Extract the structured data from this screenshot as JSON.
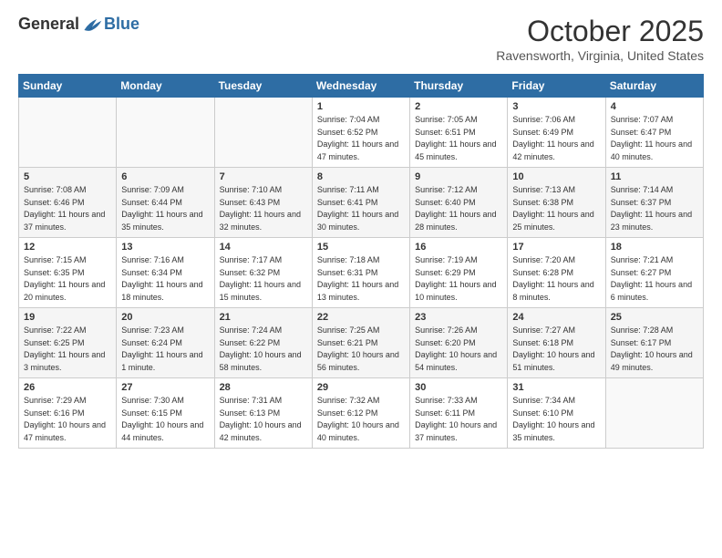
{
  "header": {
    "logo_general": "General",
    "logo_blue": "Blue",
    "month_title": "October 2025",
    "location": "Ravensworth, Virginia, United States"
  },
  "days_of_week": [
    "Sunday",
    "Monday",
    "Tuesday",
    "Wednesday",
    "Thursday",
    "Friday",
    "Saturday"
  ],
  "weeks": [
    [
      {
        "day": "",
        "sunrise": "",
        "sunset": "",
        "daylight": ""
      },
      {
        "day": "",
        "sunrise": "",
        "sunset": "",
        "daylight": ""
      },
      {
        "day": "",
        "sunrise": "",
        "sunset": "",
        "daylight": ""
      },
      {
        "day": "1",
        "sunrise": "Sunrise: 7:04 AM",
        "sunset": "Sunset: 6:52 PM",
        "daylight": "Daylight: 11 hours and 47 minutes."
      },
      {
        "day": "2",
        "sunrise": "Sunrise: 7:05 AM",
        "sunset": "Sunset: 6:51 PM",
        "daylight": "Daylight: 11 hours and 45 minutes."
      },
      {
        "day": "3",
        "sunrise": "Sunrise: 7:06 AM",
        "sunset": "Sunset: 6:49 PM",
        "daylight": "Daylight: 11 hours and 42 minutes."
      },
      {
        "day": "4",
        "sunrise": "Sunrise: 7:07 AM",
        "sunset": "Sunset: 6:47 PM",
        "daylight": "Daylight: 11 hours and 40 minutes."
      }
    ],
    [
      {
        "day": "5",
        "sunrise": "Sunrise: 7:08 AM",
        "sunset": "Sunset: 6:46 PM",
        "daylight": "Daylight: 11 hours and 37 minutes."
      },
      {
        "day": "6",
        "sunrise": "Sunrise: 7:09 AM",
        "sunset": "Sunset: 6:44 PM",
        "daylight": "Daylight: 11 hours and 35 minutes."
      },
      {
        "day": "7",
        "sunrise": "Sunrise: 7:10 AM",
        "sunset": "Sunset: 6:43 PM",
        "daylight": "Daylight: 11 hours and 32 minutes."
      },
      {
        "day": "8",
        "sunrise": "Sunrise: 7:11 AM",
        "sunset": "Sunset: 6:41 PM",
        "daylight": "Daylight: 11 hours and 30 minutes."
      },
      {
        "day": "9",
        "sunrise": "Sunrise: 7:12 AM",
        "sunset": "Sunset: 6:40 PM",
        "daylight": "Daylight: 11 hours and 28 minutes."
      },
      {
        "day": "10",
        "sunrise": "Sunrise: 7:13 AM",
        "sunset": "Sunset: 6:38 PM",
        "daylight": "Daylight: 11 hours and 25 minutes."
      },
      {
        "day": "11",
        "sunrise": "Sunrise: 7:14 AM",
        "sunset": "Sunset: 6:37 PM",
        "daylight": "Daylight: 11 hours and 23 minutes."
      }
    ],
    [
      {
        "day": "12",
        "sunrise": "Sunrise: 7:15 AM",
        "sunset": "Sunset: 6:35 PM",
        "daylight": "Daylight: 11 hours and 20 minutes."
      },
      {
        "day": "13",
        "sunrise": "Sunrise: 7:16 AM",
        "sunset": "Sunset: 6:34 PM",
        "daylight": "Daylight: 11 hours and 18 minutes."
      },
      {
        "day": "14",
        "sunrise": "Sunrise: 7:17 AM",
        "sunset": "Sunset: 6:32 PM",
        "daylight": "Daylight: 11 hours and 15 minutes."
      },
      {
        "day": "15",
        "sunrise": "Sunrise: 7:18 AM",
        "sunset": "Sunset: 6:31 PM",
        "daylight": "Daylight: 11 hours and 13 minutes."
      },
      {
        "day": "16",
        "sunrise": "Sunrise: 7:19 AM",
        "sunset": "Sunset: 6:29 PM",
        "daylight": "Daylight: 11 hours and 10 minutes."
      },
      {
        "day": "17",
        "sunrise": "Sunrise: 7:20 AM",
        "sunset": "Sunset: 6:28 PM",
        "daylight": "Daylight: 11 hours and 8 minutes."
      },
      {
        "day": "18",
        "sunrise": "Sunrise: 7:21 AM",
        "sunset": "Sunset: 6:27 PM",
        "daylight": "Daylight: 11 hours and 6 minutes."
      }
    ],
    [
      {
        "day": "19",
        "sunrise": "Sunrise: 7:22 AM",
        "sunset": "Sunset: 6:25 PM",
        "daylight": "Daylight: 11 hours and 3 minutes."
      },
      {
        "day": "20",
        "sunrise": "Sunrise: 7:23 AM",
        "sunset": "Sunset: 6:24 PM",
        "daylight": "Daylight: 11 hours and 1 minute."
      },
      {
        "day": "21",
        "sunrise": "Sunrise: 7:24 AM",
        "sunset": "Sunset: 6:22 PM",
        "daylight": "Daylight: 10 hours and 58 minutes."
      },
      {
        "day": "22",
        "sunrise": "Sunrise: 7:25 AM",
        "sunset": "Sunset: 6:21 PM",
        "daylight": "Daylight: 10 hours and 56 minutes."
      },
      {
        "day": "23",
        "sunrise": "Sunrise: 7:26 AM",
        "sunset": "Sunset: 6:20 PM",
        "daylight": "Daylight: 10 hours and 54 minutes."
      },
      {
        "day": "24",
        "sunrise": "Sunrise: 7:27 AM",
        "sunset": "Sunset: 6:18 PM",
        "daylight": "Daylight: 10 hours and 51 minutes."
      },
      {
        "day": "25",
        "sunrise": "Sunrise: 7:28 AM",
        "sunset": "Sunset: 6:17 PM",
        "daylight": "Daylight: 10 hours and 49 minutes."
      }
    ],
    [
      {
        "day": "26",
        "sunrise": "Sunrise: 7:29 AM",
        "sunset": "Sunset: 6:16 PM",
        "daylight": "Daylight: 10 hours and 47 minutes."
      },
      {
        "day": "27",
        "sunrise": "Sunrise: 7:30 AM",
        "sunset": "Sunset: 6:15 PM",
        "daylight": "Daylight: 10 hours and 44 minutes."
      },
      {
        "day": "28",
        "sunrise": "Sunrise: 7:31 AM",
        "sunset": "Sunset: 6:13 PM",
        "daylight": "Daylight: 10 hours and 42 minutes."
      },
      {
        "day": "29",
        "sunrise": "Sunrise: 7:32 AM",
        "sunset": "Sunset: 6:12 PM",
        "daylight": "Daylight: 10 hours and 40 minutes."
      },
      {
        "day": "30",
        "sunrise": "Sunrise: 7:33 AM",
        "sunset": "Sunset: 6:11 PM",
        "daylight": "Daylight: 10 hours and 37 minutes."
      },
      {
        "day": "31",
        "sunrise": "Sunrise: 7:34 AM",
        "sunset": "Sunset: 6:10 PM",
        "daylight": "Daylight: 10 hours and 35 minutes."
      },
      {
        "day": "",
        "sunrise": "",
        "sunset": "",
        "daylight": ""
      }
    ]
  ]
}
